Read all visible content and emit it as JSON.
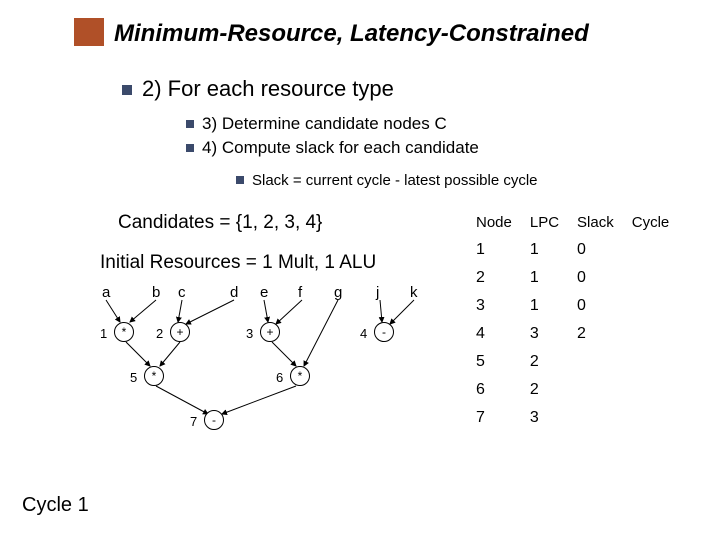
{
  "title": "Minimum-Resource, Latency-Constrained",
  "bullet1": "2) For each resource type",
  "bullet2a": "3) Determine candidate nodes C",
  "bullet2b": "4) Compute slack for each candidate",
  "bullet3": "Slack = current cycle - latest possible cycle",
  "candidates": "Candidates = {1, 2, 3, 4}",
  "initial": "Initial Resources = 1 Mult, 1 ALU",
  "cycle_label": "Cycle 1",
  "graph": {
    "top_labels": [
      "a",
      "b",
      "c",
      "d",
      "e",
      "f",
      "g",
      "j",
      "k"
    ],
    "nodes": [
      {
        "id": "1",
        "op": "*"
      },
      {
        "id": "2",
        "op": "+"
      },
      {
        "id": "3",
        "op": "+"
      },
      {
        "id": "4",
        "op": "-"
      },
      {
        "id": "5",
        "op": "*"
      },
      {
        "id": "6",
        "op": "*"
      },
      {
        "id": "7",
        "op": "-"
      }
    ]
  },
  "table": {
    "headers": [
      "Node",
      "LPC",
      "Slack",
      "Cycle"
    ],
    "rows": [
      [
        "1",
        "1",
        "0",
        ""
      ],
      [
        "2",
        "1",
        "0",
        ""
      ],
      [
        "3",
        "1",
        "0",
        ""
      ],
      [
        "4",
        "3",
        "2",
        ""
      ],
      [
        "5",
        "2",
        "",
        ""
      ],
      [
        "6",
        "2",
        "",
        ""
      ],
      [
        "7",
        "3",
        "",
        ""
      ]
    ]
  }
}
